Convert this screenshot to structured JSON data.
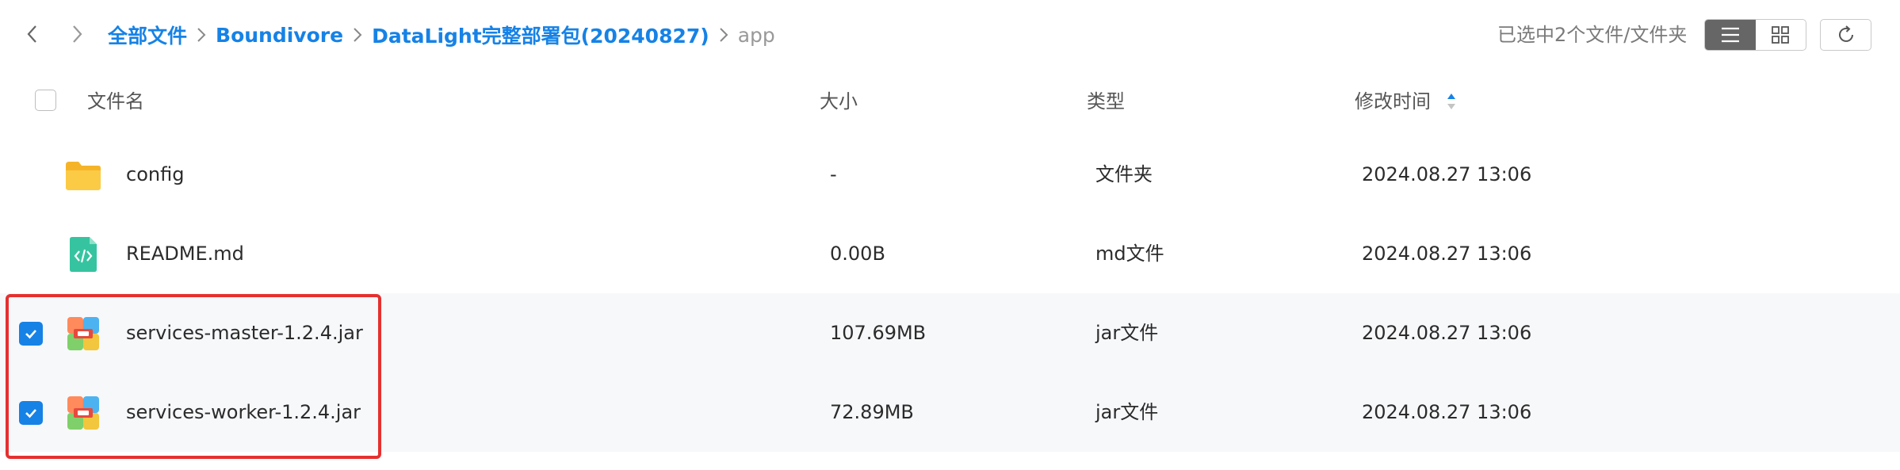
{
  "breadcrumb": {
    "items": [
      "全部文件",
      "Boundivore",
      "DataLight完整部署包(20240827)"
    ],
    "current": "app"
  },
  "toolbar": {
    "selection_info": "已选中2个文件/文件夹",
    "view_modes": [
      "list",
      "grid"
    ],
    "active_view": "list"
  },
  "columns": {
    "name": "文件名",
    "size": "大小",
    "type": "类型",
    "modified": "修改时间",
    "sorted_by": "修改时间"
  },
  "files": [
    {
      "name": "config",
      "size": "-",
      "type": "文件夹",
      "modified": "2024.08.27 13:06",
      "icon": "folder-icon",
      "selected": false
    },
    {
      "name": "README.md",
      "size": "0.00B",
      "type": "md文件",
      "modified": "2024.08.27 13:06",
      "icon": "code-file-icon",
      "selected": false
    },
    {
      "name": "services-master-1.2.4.jar",
      "size": "107.69MB",
      "type": "jar文件",
      "modified": "2024.08.27 13:06",
      "icon": "archive-icon",
      "selected": true
    },
    {
      "name": "services-worker-1.2.4.jar",
      "size": "72.89MB",
      "type": "jar文件",
      "modified": "2024.08.27 13:06",
      "icon": "archive-icon",
      "selected": true
    }
  ],
  "colors": {
    "accent": "#1682e6",
    "highlight_border": "#e53030",
    "selected_row_bg": "#f7f8fa"
  }
}
